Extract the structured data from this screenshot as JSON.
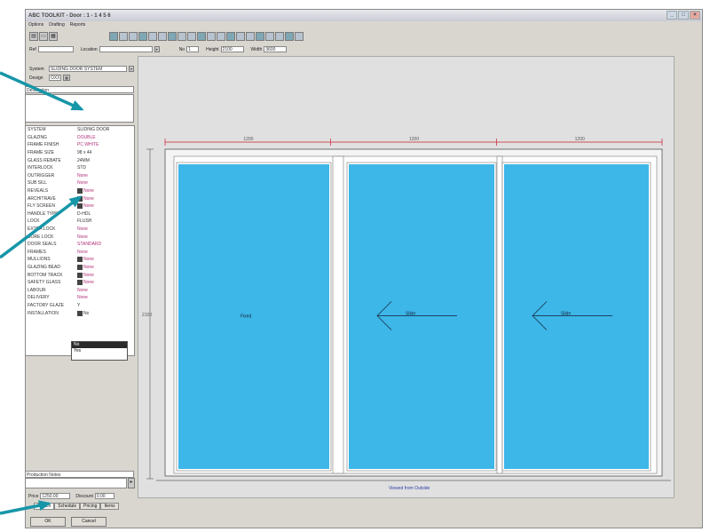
{
  "window": {
    "title": "ABC TOOLKIT - Door : 1 - 1 4 5 6"
  },
  "menu": [
    "Options",
    "Drafting",
    "Reports"
  ],
  "toolbar": {
    "left_buttons": [
      "save-icon",
      "folder-icon",
      "print-icon"
    ],
    "main_buttons": [
      "tool-1",
      "tool-2",
      "tool-3",
      "tool-4",
      "tool-5",
      "tool-6",
      "tool-7",
      "tool-8",
      "tool-9",
      "tool-10",
      "tool-11",
      "tool-12",
      "tool-13",
      "tool-14",
      "tool-15",
      "tool-16",
      "tool-17",
      "tool-18",
      "tool-19",
      "tool-20"
    ]
  },
  "header": {
    "ref_label": "Ref",
    "location_label": "Location",
    "no_label": "No",
    "no_value": "1",
    "height_label": "Height",
    "height_value": "2100",
    "width_label": "Width",
    "width_value": "3600"
  },
  "system": {
    "label": "System",
    "value": "SLIDING DOOR SYSTEM"
  },
  "design": {
    "label": "Design",
    "value": "OXX"
  },
  "description": {
    "label": "Description"
  },
  "properties": [
    {
      "name": "SYSTEM",
      "value": "SLIDING DOOR",
      "color": "plain"
    },
    {
      "name": "GLAZING",
      "value": "DOUBLE",
      "color": "pink"
    },
    {
      "name": "FRAME FINISH",
      "value": "PC WHITE",
      "color": "pink"
    },
    {
      "name": "FRAME SIZE",
      "value": "98 x 44",
      "color": "plain"
    },
    {
      "name": "GLASS REBATE",
      "value": "24MM",
      "color": "plain"
    },
    {
      "name": "INTERLOCK",
      "value": "STD",
      "color": "plain"
    },
    {
      "name": "OUTRIGGER",
      "value": "None",
      "color": "pink"
    },
    {
      "name": "SUB SILL",
      "value": "None",
      "color": "pink"
    },
    {
      "name": "REVEALS",
      "value": "None",
      "color": "pink",
      "dropdown": true
    },
    {
      "name": "ARCHITRAVE",
      "value": "None",
      "color": "pink",
      "dropdown": true
    },
    {
      "name": "FLY SCREEN",
      "value": "None",
      "color": "pink",
      "dropdown": true
    },
    {
      "name": "HANDLE TYPE",
      "value": "D-HDL",
      "color": "plain"
    },
    {
      "name": "LOCK",
      "value": "FLUSH",
      "color": "plain"
    },
    {
      "name": "EXTRA LOCK",
      "value": "None",
      "color": "pink"
    },
    {
      "name": "CORE LOCK",
      "value": "None",
      "color": "pink"
    },
    {
      "name": "DOOR SEALS",
      "value": "STANDARD",
      "color": "pink"
    },
    {
      "name": "FRAMES",
      "value": "None",
      "color": "pink"
    },
    {
      "name": "MULLIONS",
      "value": "None",
      "color": "pink",
      "dropdown": true
    },
    {
      "name": "GLAZING BEAD",
      "value": "None",
      "color": "pink",
      "dropdown": true
    },
    {
      "name": "BOTTOM TRACK",
      "value": "None",
      "color": "pink",
      "dropdown": true
    },
    {
      "name": "SAFETY GLASS",
      "value": "None",
      "color": "pink",
      "dropdown": true
    },
    {
      "name": "LABOUR",
      "value": "None",
      "color": "pink"
    },
    {
      "name": "DELIVERY",
      "value": "None",
      "color": "pink"
    },
    {
      "name": "FACTORY GLAZE",
      "value": "Y",
      "color": "plain"
    },
    {
      "name": "INSTALLATION",
      "value": "No",
      "color": "plain",
      "dropdown": true
    }
  ],
  "install_options": [
    "No",
    "Yes"
  ],
  "bottom": {
    "box_label": "Production Notes",
    "price_label": "Price",
    "price_value": "1250.00",
    "discount_label": "Discount",
    "discount_value": "0.00"
  },
  "tabs": [
    "Sketch",
    "Schedule",
    "Pricing",
    "Items"
  ],
  "actions": {
    "ok": "OK",
    "cancel": "Cancel"
  },
  "drawing": {
    "panel_color": "#3db6e8",
    "dimension_color": "#c2202a",
    "dim_top": [
      "1200",
      "1200",
      "1200"
    ],
    "dim_side": "2100",
    "panel_labels": [
      "Fixed",
      "Slide",
      "Slide"
    ],
    "caption": "Viewed from Outside"
  },
  "callout_color": "#1796a8"
}
